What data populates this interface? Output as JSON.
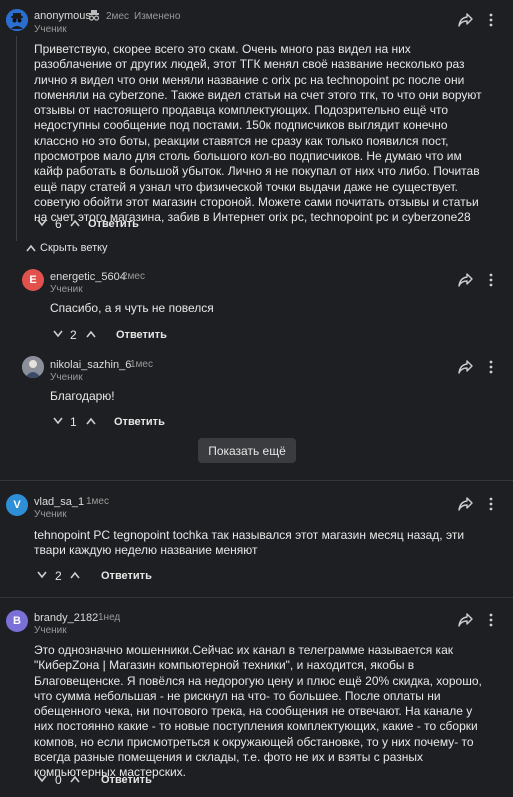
{
  "comments": [
    {
      "name": "anonymous",
      "time": "2мес",
      "edited": "Изменено",
      "role": "Ученик",
      "text": "Приветствую, скорее всего это скам. Очень много раз видел на них разоблачение от других людей, этот ТГК менял своё название несколько раз лично я видел что они меняли название с orix pc на technopoint pc после они поменяли на cyberzone. Также видел статьи на счет этого тгк, то что они воруют отзывы от настоящего продавца комплектующих. Подозрительно ещё что недоступны сообщение под постами. 150к подписчиков выглядит конечно классно но это боты, реакции ставятся не сразу как только появился пост, просмотров мало для столь большого кол-во подписчиков. Не думаю что им кайф работать в большой убыток. Лично я не покупал от них что либо. Почитав ещё пару статей я узнал что физической точки выдачи даже не существует. советую обойти этот магазин стороной. Можете сами почитать отзывы и статьи на счет этого магазина, забив в Интернет orix pc, technopoint pc и cyberzone28",
      "votes": "6",
      "reply": "Ответить"
    },
    {
      "name": "energetic_5604",
      "avatar_letter": "E",
      "time": "2мес",
      "role": "Ученик",
      "text": "Спасибо, а я чуть не повелся",
      "votes": "2",
      "reply": "Ответить"
    },
    {
      "name": "nikolai_sazhin_6",
      "time": "1мес",
      "role": "Ученик",
      "text": "Благодарю!",
      "votes": "1",
      "reply": "Ответить"
    },
    {
      "name": "vlad_sa_1",
      "avatar_letter": "V",
      "time": "1мес",
      "role": "Ученик",
      "text": "tehnopoint PC tegnopoint tochka так назывался этот магазин месяц назад, эти твари каждую неделю название меняют",
      "votes": "2",
      "reply": "Ответить"
    },
    {
      "name": "brandy_2182",
      "avatar_letter": "B",
      "time": "1нед",
      "role": "Ученик",
      "text": "Это однозначно мошенники.Сейчас их канал в телеграмме называется как \"КиберZона | Магазин компьютерной техники\", и находится, якобы в Благовещенске. Я повёлся на недорогую цену и плюс ещё 20% скидка, хорошо, что сумма небольшая - не рискнул на что- то большее. После оплаты ни обещенного чека, ни почтового трека, на сообщения не отвечают. На канале у них постоянно какие - то новые поступления комплектующих, какие - то сборки компов, но если присмотреться к окружающей обстановке, то у них почему- то всегда разные помещения и склады, т.е. фото не их и взяты с разных компьютерных мастерских.",
      "votes": "0",
      "reply": "Ответить"
    }
  ],
  "hide_thread": "Скрыть ветку",
  "show_more": "Показать ещё",
  "colors": {
    "bg": "#1e1f22",
    "energetic": "#e0524b",
    "vlad": "#2e8fd6",
    "brandy": "#7b6fd8"
  }
}
